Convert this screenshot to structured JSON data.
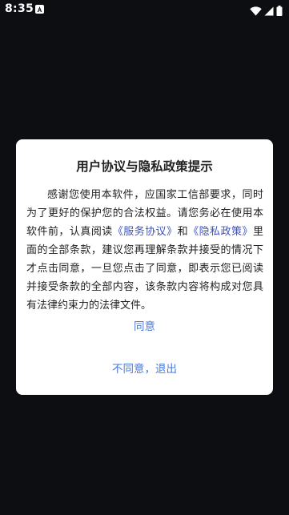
{
  "status_bar": {
    "time": "8:35",
    "notification_icon": "a-notification-icon",
    "icons": [
      "wifi-icon",
      "cell-signal-icon",
      "battery-icon"
    ]
  },
  "dialog": {
    "title": "用户协议与隐私政策提示",
    "body": {
      "text_before": "感谢您使用本软件，应国家工信部要求，同时为了更好的保护您的合法权益。请您务必在使用本软件前，认真阅读",
      "link_service": "《服务协议》",
      "text_and": "和",
      "link_privacy": "《隐私政策》",
      "text_after": "里面的全部条款，建议您再理解条款并接受的情况下才点击同意，一旦您点击了同意，即表示您已阅读并接受条款的全部内容，该条款内容将构成对您具有法律约束力的法律文件。"
    },
    "agree_label": "同意",
    "disagree_label": "不同意，退出"
  },
  "colors": {
    "background": "#0d0e12",
    "dialog_bg": "#ffffff",
    "link": "#3c52c4",
    "button": "#4a79d8"
  }
}
